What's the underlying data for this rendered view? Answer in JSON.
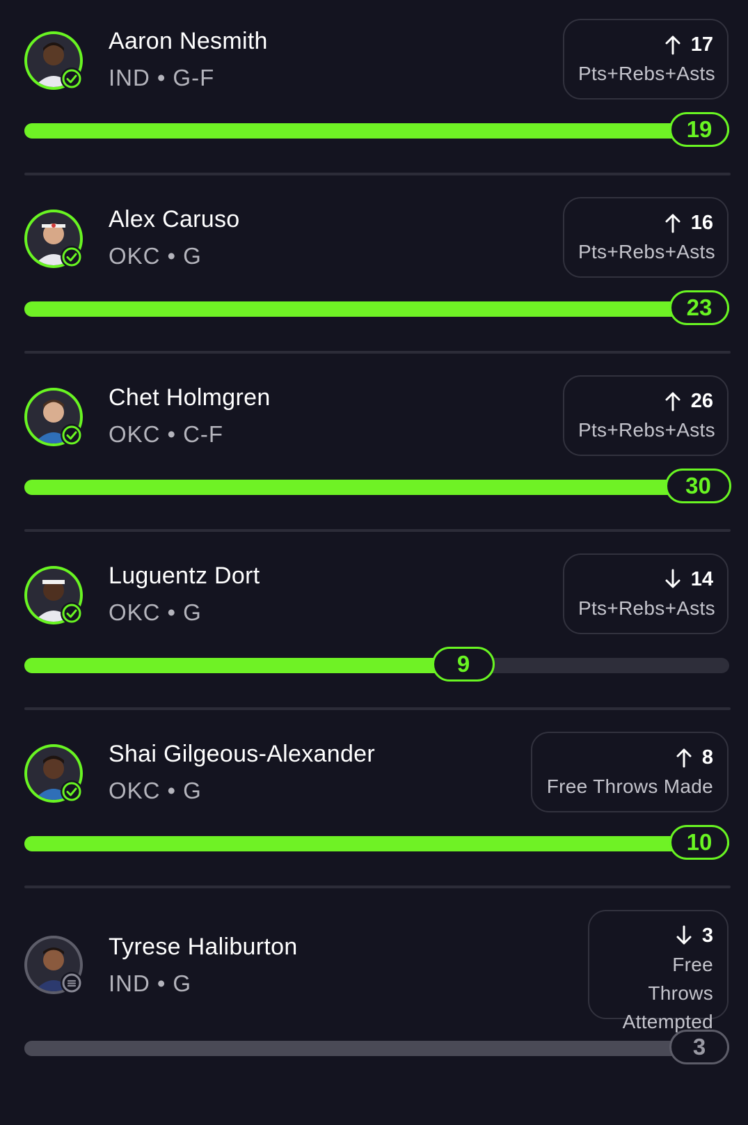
{
  "colors": {
    "background": "#141420",
    "accent_green": "#69f522",
    "track": "#2e2e3a",
    "pending_grey": "#5c5c68"
  },
  "players": [
    {
      "name": "Aaron Nesmith",
      "team": "IND",
      "position": "G-F",
      "status": "complete",
      "status_icon": "check-circle-icon",
      "direction": "up",
      "direction_icon": "arrow-up-icon",
      "line": "17",
      "stat_label": "Pts+Rebs+Asts",
      "result": "19",
      "progress_fraction": 1.0
    },
    {
      "name": "Alex Caruso",
      "team": "OKC",
      "position": "G",
      "status": "complete",
      "status_icon": "check-circle-icon",
      "direction": "up",
      "direction_icon": "arrow-up-icon",
      "line": "16",
      "stat_label": "Pts+Rebs+Asts",
      "result": "23",
      "progress_fraction": 1.0
    },
    {
      "name": "Chet Holmgren",
      "team": "OKC",
      "position": "C-F",
      "status": "complete",
      "status_icon": "check-circle-icon",
      "direction": "up",
      "direction_icon": "arrow-up-icon",
      "line": "26",
      "stat_label": "Pts+Rebs+Asts",
      "result": "30",
      "progress_fraction": 1.0
    },
    {
      "name": "Luguentz Dort",
      "team": "OKC",
      "position": "G",
      "status": "complete",
      "status_icon": "check-circle-icon",
      "direction": "down",
      "direction_icon": "arrow-down-icon",
      "line": "14",
      "stat_label": "Pts+Rebs+Asts",
      "result": "9",
      "progress_fraction": 0.643
    },
    {
      "name": "Shai Gilgeous-Alexander",
      "team": "OKC",
      "position": "G",
      "status": "complete",
      "status_icon": "check-circle-icon",
      "direction": "up",
      "direction_icon": "arrow-up-icon",
      "line": "8",
      "stat_label": "Free Throws Made",
      "result": "10",
      "progress_fraction": 1.0
    },
    {
      "name": "Tyrese Haliburton",
      "team": "IND",
      "position": "G",
      "status": "pending",
      "status_icon": "equals-circle-icon",
      "direction": "down",
      "direction_icon": "arrow-down-icon",
      "line": "3",
      "stat_label_lines": [
        "Free Throws",
        "Attempted"
      ],
      "result": "3",
      "progress_fraction": 1.0
    }
  ]
}
